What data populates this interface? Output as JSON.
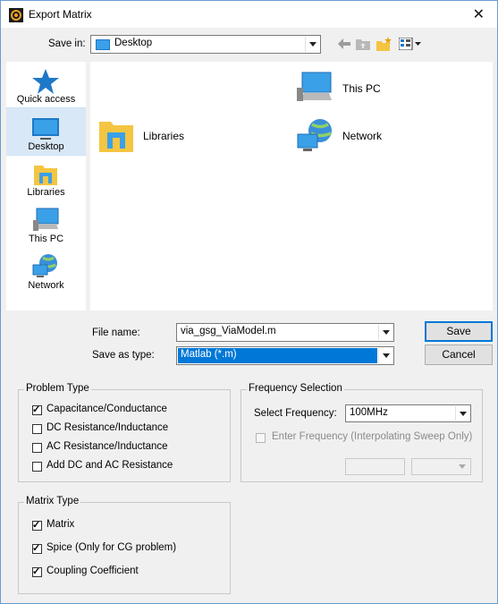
{
  "window": {
    "title": "Export Matrix",
    "close_glyph": "✕"
  },
  "save_in": {
    "label": "Save in:",
    "value": "Desktop"
  },
  "toolbar_icons": [
    "back-arrow-icon",
    "up-folder-icon",
    "new-folder-icon",
    "view-menu-icon"
  ],
  "places": [
    {
      "label": "Quick access",
      "icon": "star-icon"
    },
    {
      "label": "Desktop",
      "icon": "desktop-icon",
      "selected": true
    },
    {
      "label": "Libraries",
      "icon": "libraries-folder-icon"
    },
    {
      "label": "This PC",
      "icon": "computer-icon"
    },
    {
      "label": "Network",
      "icon": "network-globe-icon"
    }
  ],
  "files": [
    {
      "label": "This PC",
      "icon": "computer-icon"
    },
    {
      "label": "Libraries",
      "icon": "libraries-folder-icon"
    },
    {
      "label": "Network",
      "icon": "network-globe-icon"
    }
  ],
  "file_name": {
    "label": "File name:",
    "value": "via_gsg_ViaModel.m"
  },
  "save_as_type": {
    "label": "Save as type:",
    "value": "Matlab (*.m)"
  },
  "buttons": {
    "save": "Save",
    "cancel": "Cancel"
  },
  "problem_type": {
    "title": "Problem Type",
    "options": [
      {
        "label": "Capacitance/Conductance",
        "checked": true
      },
      {
        "label": "DC Resistance/Inductance",
        "checked": false
      },
      {
        "label": "AC Resistance/Inductance",
        "checked": false
      },
      {
        "label": "Add DC and AC Resistance",
        "checked": false
      }
    ]
  },
  "frequency": {
    "title": "Frequency Selection",
    "select_label": "Select Frequency:",
    "select_value": "100MHz",
    "enter_label": "Enter Frequency (Interpolating Sweep Only)",
    "enter_checked": false
  },
  "matrix_type": {
    "title": "Matrix Type",
    "options": [
      {
        "label": "Matrix",
        "checked": true
      },
      {
        "label": "Spice (Only for CG problem)",
        "checked": true
      },
      {
        "label": "Coupling Coefficient",
        "checked": true
      }
    ]
  },
  "colors": {
    "selection": "#0078d7",
    "accent_blue": "#1e78c8",
    "folder_yellow": "#f4c542"
  }
}
